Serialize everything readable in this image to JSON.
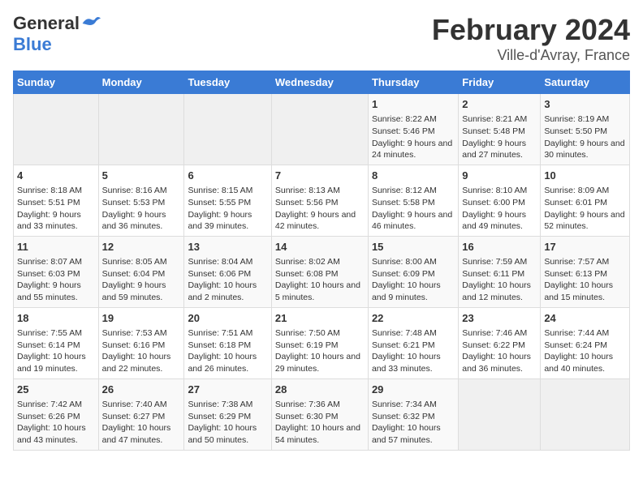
{
  "logo": {
    "general": "General",
    "blue": "Blue"
  },
  "title": "February 2024",
  "subtitle": "Ville-d'Avray, France",
  "days_of_week": [
    "Sunday",
    "Monday",
    "Tuesday",
    "Wednesday",
    "Thursday",
    "Friday",
    "Saturday"
  ],
  "weeks": [
    [
      {
        "day": "",
        "content": ""
      },
      {
        "day": "",
        "content": ""
      },
      {
        "day": "",
        "content": ""
      },
      {
        "day": "",
        "content": ""
      },
      {
        "day": "1",
        "content": "Sunrise: 8:22 AM\nSunset: 5:46 PM\nDaylight: 9 hours and 24 minutes."
      },
      {
        "day": "2",
        "content": "Sunrise: 8:21 AM\nSunset: 5:48 PM\nDaylight: 9 hours and 27 minutes."
      },
      {
        "day": "3",
        "content": "Sunrise: 8:19 AM\nSunset: 5:50 PM\nDaylight: 9 hours and 30 minutes."
      }
    ],
    [
      {
        "day": "4",
        "content": "Sunrise: 8:18 AM\nSunset: 5:51 PM\nDaylight: 9 hours and 33 minutes."
      },
      {
        "day": "5",
        "content": "Sunrise: 8:16 AM\nSunset: 5:53 PM\nDaylight: 9 hours and 36 minutes."
      },
      {
        "day": "6",
        "content": "Sunrise: 8:15 AM\nSunset: 5:55 PM\nDaylight: 9 hours and 39 minutes."
      },
      {
        "day": "7",
        "content": "Sunrise: 8:13 AM\nSunset: 5:56 PM\nDaylight: 9 hours and 42 minutes."
      },
      {
        "day": "8",
        "content": "Sunrise: 8:12 AM\nSunset: 5:58 PM\nDaylight: 9 hours and 46 minutes."
      },
      {
        "day": "9",
        "content": "Sunrise: 8:10 AM\nSunset: 6:00 PM\nDaylight: 9 hours and 49 minutes."
      },
      {
        "day": "10",
        "content": "Sunrise: 8:09 AM\nSunset: 6:01 PM\nDaylight: 9 hours and 52 minutes."
      }
    ],
    [
      {
        "day": "11",
        "content": "Sunrise: 8:07 AM\nSunset: 6:03 PM\nDaylight: 9 hours and 55 minutes."
      },
      {
        "day": "12",
        "content": "Sunrise: 8:05 AM\nSunset: 6:04 PM\nDaylight: 9 hours and 59 minutes."
      },
      {
        "day": "13",
        "content": "Sunrise: 8:04 AM\nSunset: 6:06 PM\nDaylight: 10 hours and 2 minutes."
      },
      {
        "day": "14",
        "content": "Sunrise: 8:02 AM\nSunset: 6:08 PM\nDaylight: 10 hours and 5 minutes."
      },
      {
        "day": "15",
        "content": "Sunrise: 8:00 AM\nSunset: 6:09 PM\nDaylight: 10 hours and 9 minutes."
      },
      {
        "day": "16",
        "content": "Sunrise: 7:59 AM\nSunset: 6:11 PM\nDaylight: 10 hours and 12 minutes."
      },
      {
        "day": "17",
        "content": "Sunrise: 7:57 AM\nSunset: 6:13 PM\nDaylight: 10 hours and 15 minutes."
      }
    ],
    [
      {
        "day": "18",
        "content": "Sunrise: 7:55 AM\nSunset: 6:14 PM\nDaylight: 10 hours and 19 minutes."
      },
      {
        "day": "19",
        "content": "Sunrise: 7:53 AM\nSunset: 6:16 PM\nDaylight: 10 hours and 22 minutes."
      },
      {
        "day": "20",
        "content": "Sunrise: 7:51 AM\nSunset: 6:18 PM\nDaylight: 10 hours and 26 minutes."
      },
      {
        "day": "21",
        "content": "Sunrise: 7:50 AM\nSunset: 6:19 PM\nDaylight: 10 hours and 29 minutes."
      },
      {
        "day": "22",
        "content": "Sunrise: 7:48 AM\nSunset: 6:21 PM\nDaylight: 10 hours and 33 minutes."
      },
      {
        "day": "23",
        "content": "Sunrise: 7:46 AM\nSunset: 6:22 PM\nDaylight: 10 hours and 36 minutes."
      },
      {
        "day": "24",
        "content": "Sunrise: 7:44 AM\nSunset: 6:24 PM\nDaylight: 10 hours and 40 minutes."
      }
    ],
    [
      {
        "day": "25",
        "content": "Sunrise: 7:42 AM\nSunset: 6:26 PM\nDaylight: 10 hours and 43 minutes."
      },
      {
        "day": "26",
        "content": "Sunrise: 7:40 AM\nSunset: 6:27 PM\nDaylight: 10 hours and 47 minutes."
      },
      {
        "day": "27",
        "content": "Sunrise: 7:38 AM\nSunset: 6:29 PM\nDaylight: 10 hours and 50 minutes."
      },
      {
        "day": "28",
        "content": "Sunrise: 7:36 AM\nSunset: 6:30 PM\nDaylight: 10 hours and 54 minutes."
      },
      {
        "day": "29",
        "content": "Sunrise: 7:34 AM\nSunset: 6:32 PM\nDaylight: 10 hours and 57 minutes."
      },
      {
        "day": "",
        "content": ""
      },
      {
        "day": "",
        "content": ""
      }
    ]
  ]
}
